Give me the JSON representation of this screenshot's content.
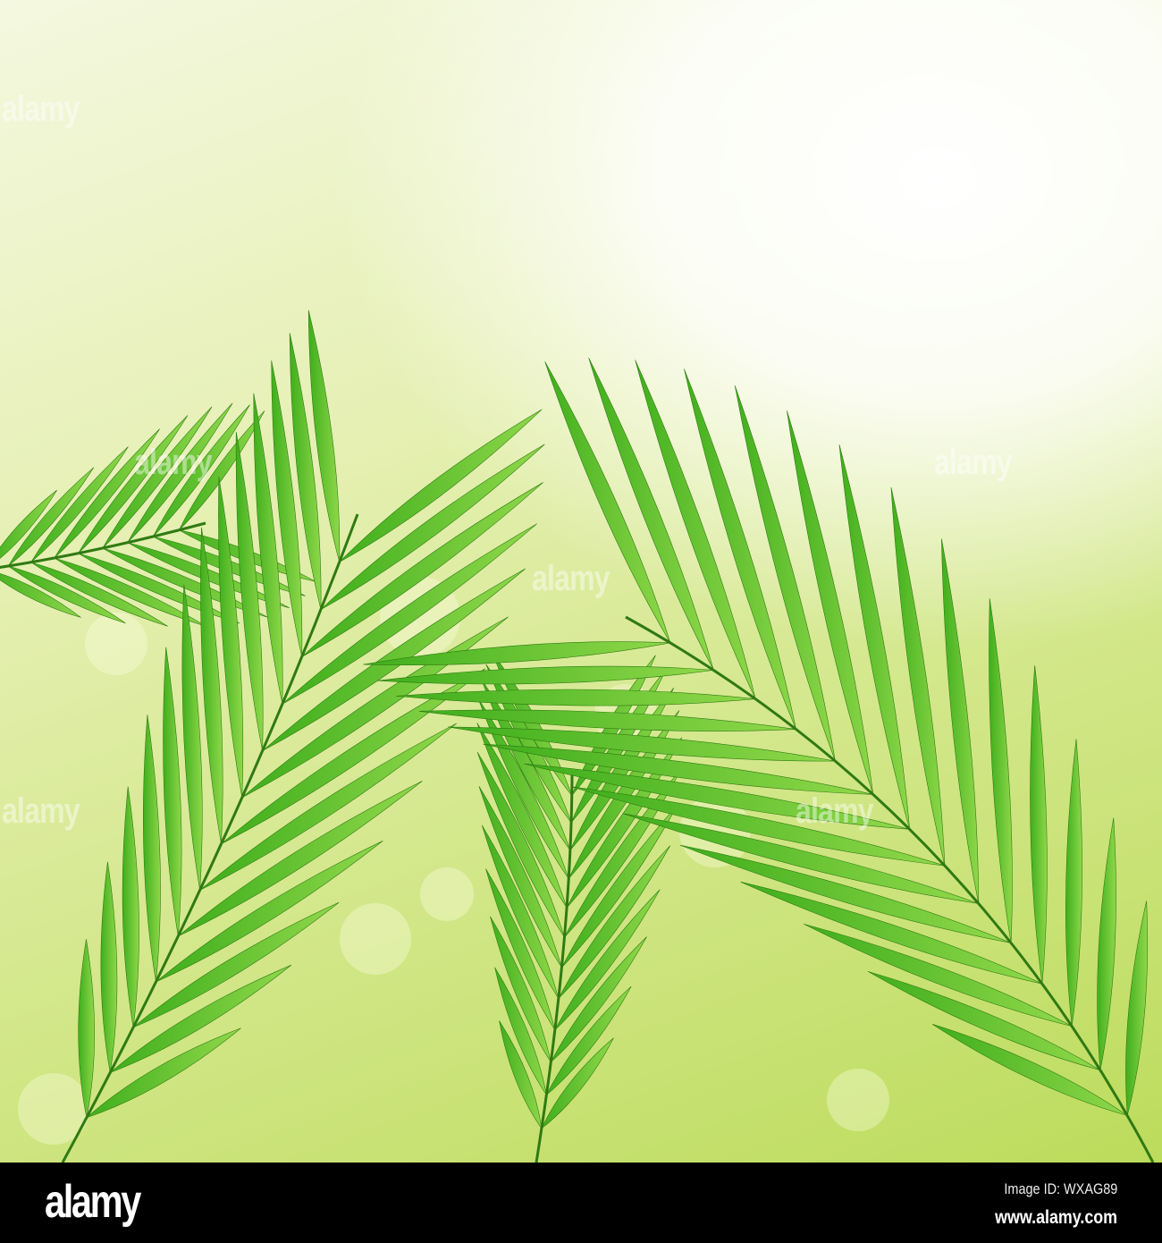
{
  "photo": {
    "subject": "green palm leaves on light green background",
    "watermark_text": "alamy",
    "colors": {
      "leaf": "#3fae1c",
      "leaf_light": "#8fd84a",
      "stem": "#2f7a12"
    }
  },
  "footer": {
    "logo": "alamy",
    "image_id": "Image ID: WXAG89",
    "website": "www.alamy.com"
  }
}
